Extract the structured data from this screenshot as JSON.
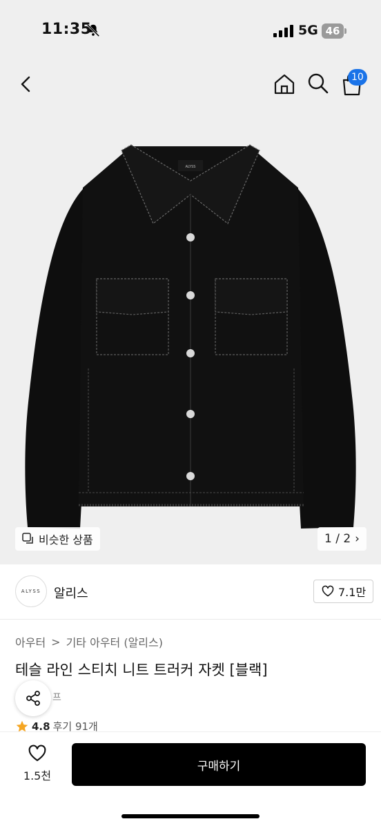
{
  "status": {
    "time": "11:35",
    "network": "5G",
    "battery": "46"
  },
  "nav": {
    "cart_badge": "10"
  },
  "hero": {
    "similar_label": "비슷한 상품",
    "pager": "1 / 2",
    "pager_arrow": "›",
    "garment_label": "ALYSS"
  },
  "brand": {
    "logo_text": "ALYSS",
    "name": "알리스",
    "likes": "7.1만"
  },
  "product": {
    "breadcrumb": [
      "아우터",
      "기타 아우터 (알리스)"
    ],
    "breadcrumb_sep": ">",
    "title": "테슬 라인 스티치 니트 트러커 자켓 [블랙]",
    "subtext": "프",
    "rating": "4.8",
    "reviews": "후기 91개"
  },
  "bottom": {
    "wish_count": "1.5천",
    "buy_label": "구매하기"
  },
  "colors": {
    "accent": "#1a73e8",
    "star": "#f5a623",
    "button": "#000000"
  }
}
